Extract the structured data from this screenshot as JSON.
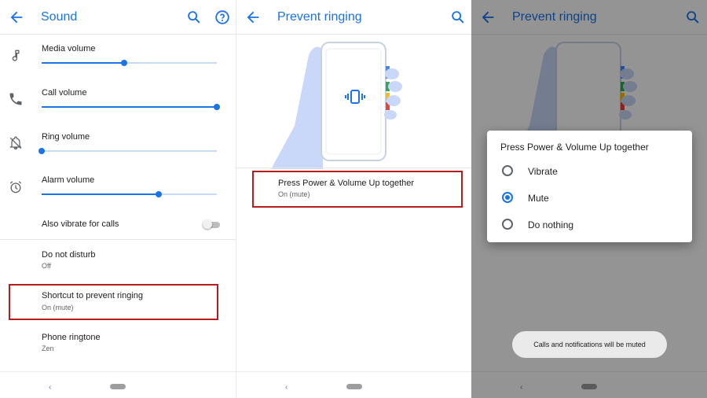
{
  "colors": {
    "accent": "#1a73e8",
    "highlight_border": "#b71c1c",
    "track": "#c6dafc"
  },
  "panel1": {
    "title": "Sound",
    "icons": {
      "back": "arrow-back-icon",
      "search": "search-icon",
      "help": "help-icon"
    },
    "volumes": [
      {
        "label": "Media volume",
        "icon": "music-note-icon",
        "level": 0.47
      },
      {
        "label": "Call volume",
        "icon": "phone-icon",
        "level": 1.0
      },
      {
        "label": "Ring volume",
        "icon": "bell-off-icon",
        "level": 0.0
      },
      {
        "label": "Alarm volume",
        "icon": "alarm-icon",
        "level": 0.67
      }
    ],
    "vibrate": {
      "label": "Also vibrate for calls",
      "on": false
    },
    "items": [
      {
        "label": "Do not disturb",
        "sub": "Off"
      },
      {
        "label": "Shortcut to prevent ringing",
        "sub": "On (mute)"
      },
      {
        "label": "Phone ringtone",
        "sub": "Zen"
      }
    ]
  },
  "panel2": {
    "title": "Prevent ringing",
    "icons": {
      "back": "arrow-back-icon",
      "search": "search-icon"
    },
    "item": {
      "label": "Press Power & Volume Up together",
      "sub": "On (mute)"
    }
  },
  "panel3": {
    "title": "Prevent ringing",
    "dialog": {
      "title": "Press Power & Volume Up together",
      "options": [
        {
          "label": "Vibrate",
          "selected": false
        },
        {
          "label": "Mute",
          "selected": true
        },
        {
          "label": "Do nothing",
          "selected": false
        }
      ]
    },
    "toast": "Calls and notifications will be muted"
  },
  "nav": {
    "back_glyph": "‹"
  }
}
